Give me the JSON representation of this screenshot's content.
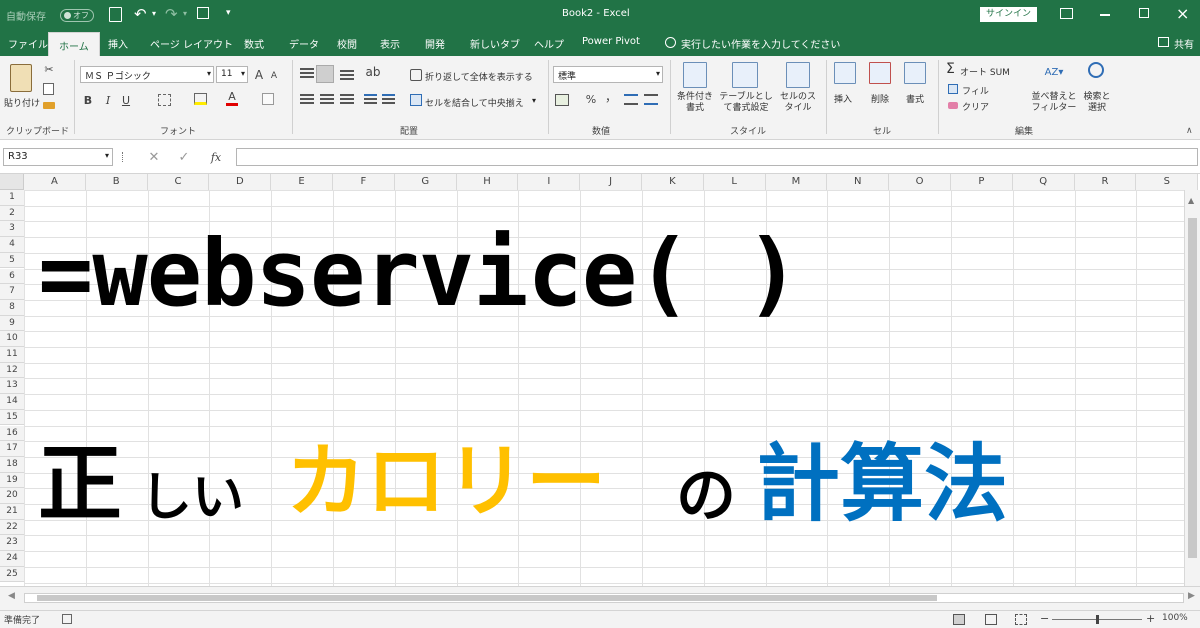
{
  "titlebar": {
    "autosave_label": "自動保存",
    "autosave_state": "オフ",
    "document_title": "Book2 - Excel",
    "signin_label": "サインイン"
  },
  "tabs": [
    "ファイル",
    "ホーム",
    "挿入",
    "ページ レイアウト",
    "数式",
    "データ",
    "校閲",
    "表示",
    "開発",
    "新しいタブ",
    "ヘルプ",
    "Power Pivot"
  ],
  "active_tab": "ホーム",
  "tell_me": "実行したい作業を入力してください",
  "share_label": "共有",
  "ribbon": {
    "clipboard": {
      "paste": "貼り付け",
      "group": "クリップボード"
    },
    "font": {
      "name": "ＭＳ Ｐゴシック",
      "size": "11",
      "group": "フォント",
      "bold": "B",
      "italic": "I",
      "underline": "U",
      "grow": "A",
      "shrink": "A",
      "color_a": "A"
    },
    "alignment": {
      "wrap": "折り返して全体を表示する",
      "merge": "セルを結合して中央揃え",
      "group": "配置"
    },
    "number": {
      "format": "標準",
      "percent": "%",
      "comma": "，",
      "group": "数値"
    },
    "styles": {
      "conditional": "条件付き書式",
      "table": "テーブルとして書式設定",
      "cell": "セルのスタイル",
      "group": "スタイル"
    },
    "cells": {
      "insert": "挿入",
      "delete": "削除",
      "format": "書式",
      "group": "セル"
    },
    "editing": {
      "autosum": "オート SUM",
      "fill": "フィル",
      "clear": "クリア",
      "sort": "並べ替えとフィルター",
      "find": "検索と選択",
      "group": "編集"
    }
  },
  "formula_bar": {
    "namebox": "R33",
    "fx": "fx",
    "formula": ""
  },
  "columns": [
    "A",
    "B",
    "C",
    "D",
    "E",
    "F",
    "G",
    "H",
    "I",
    "J",
    "K",
    "L",
    "M",
    "N",
    "O",
    "P",
    "Q",
    "R",
    "S"
  ],
  "rows": [
    "1",
    "2",
    "3",
    "4",
    "5",
    "6",
    "7",
    "8",
    "9",
    "10",
    "11",
    "12",
    "13",
    "14",
    "15",
    "16",
    "17",
    "18",
    "19",
    "20",
    "21",
    "22",
    "23",
    "24",
    "25"
  ],
  "headline": "=webservice( )",
  "subline": {
    "part1": "正",
    "part2": "しい",
    "part3": "カロリー",
    "part4": "の",
    "part5": "計算法"
  },
  "colors": {
    "excel_green": "#217346",
    "orange": "#ffc000",
    "blue": "#0070c0"
  },
  "status": {
    "ready": "準備完了",
    "zoom": "100%"
  }
}
